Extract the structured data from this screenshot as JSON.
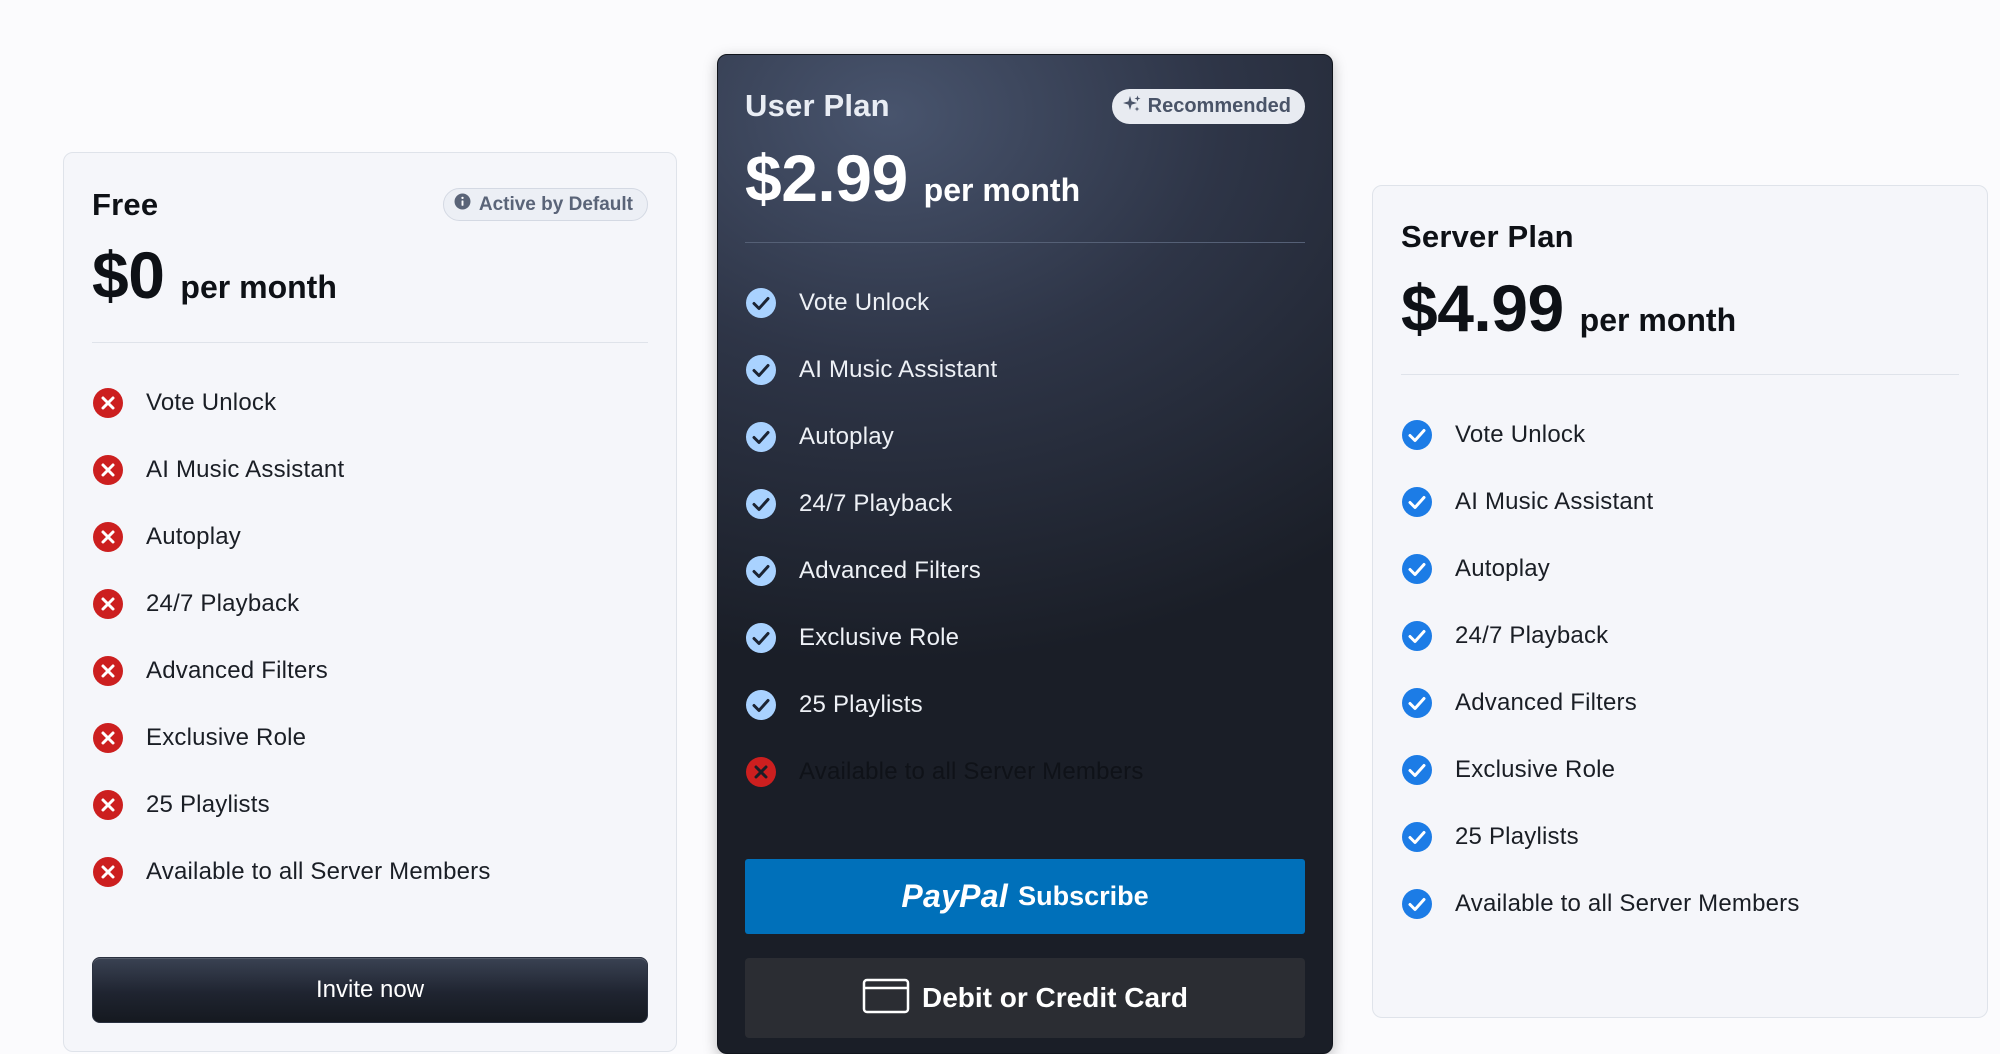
{
  "plans": {
    "free": {
      "title": "Free",
      "badge": "Active by Default",
      "price": "$0",
      "period": "per month",
      "features": [
        {
          "label": "Vote Unlock",
          "included": false
        },
        {
          "label": "AI Music Assistant",
          "included": false
        },
        {
          "label": "Autoplay",
          "included": false
        },
        {
          "label": "24/7 Playback",
          "included": false
        },
        {
          "label": "Advanced Filters",
          "included": false
        },
        {
          "label": "Exclusive Role",
          "included": false
        },
        {
          "label": "25 Playlists",
          "included": false
        },
        {
          "label": "Available to all Server Members",
          "included": false
        }
      ],
      "button_label": "Invite now"
    },
    "user": {
      "title": "User Plan",
      "badge": "Recommended",
      "price": "$2.99",
      "period": "per month",
      "features": [
        {
          "label": "Vote Unlock",
          "included": true
        },
        {
          "label": "AI Music Assistant",
          "included": true
        },
        {
          "label": "Autoplay",
          "included": true
        },
        {
          "label": "24/7 Playback",
          "included": true
        },
        {
          "label": "Advanced Filters",
          "included": true
        },
        {
          "label": "Exclusive Role",
          "included": true
        },
        {
          "label": "25 Playlists",
          "included": true
        },
        {
          "label": "Available to all Server Members",
          "included": false
        }
      ],
      "paypal_button": {
        "logo": "PayPal",
        "label": "Subscribe"
      },
      "card_button_label": "Debit or Credit Card"
    },
    "server": {
      "title": "Server Plan",
      "price": "$4.99",
      "period": "per month",
      "features": [
        {
          "label": "Vote Unlock",
          "included": true
        },
        {
          "label": "AI Music Assistant",
          "included": true
        },
        {
          "label": "Autoplay",
          "included": true
        },
        {
          "label": "24/7 Playback",
          "included": true
        },
        {
          "label": "Advanced Filters",
          "included": true
        },
        {
          "label": "Exclusive Role",
          "included": true
        },
        {
          "label": "25 Playlists",
          "included": true
        },
        {
          "label": "Available to all Server Members",
          "included": true
        }
      ]
    }
  },
  "icons": {
    "included": "check-circle-icon",
    "excluded": "x-circle-icon",
    "free_badge": "info-icon",
    "user_badge": "sparkles-icon",
    "card_button": "credit-card-icon"
  },
  "colors": {
    "excluded_red": "#cc1f1f",
    "check_blue_light": "#1c7ce6",
    "check_blue_dark": "#a9d2ff",
    "paypal_blue": "#0070ba",
    "dark_card": "#1a1e27"
  }
}
